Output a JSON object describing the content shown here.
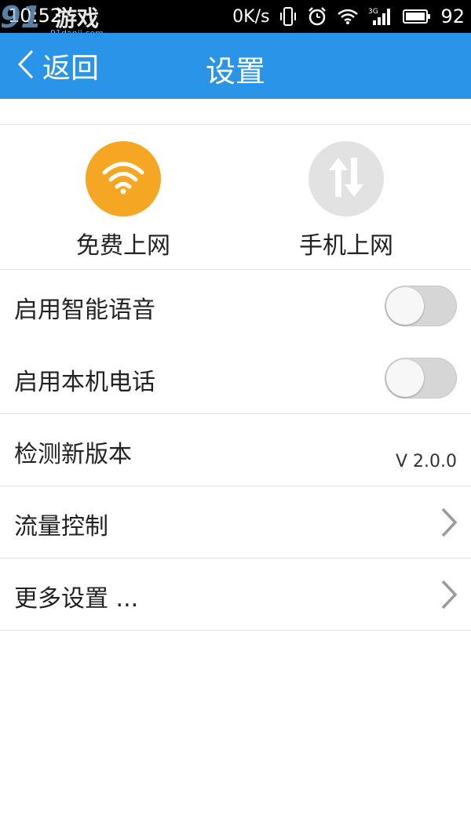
{
  "status_bar": {
    "time": "10:52",
    "speed": "0K/s",
    "battery_level": "92",
    "network_type": "3G"
  },
  "watermark": {
    "logo": "91",
    "name": "游戏",
    "url": "91danji.com"
  },
  "header": {
    "back_label": "返回",
    "title": "设置"
  },
  "network_modes": [
    {
      "label": "免费上网",
      "icon": "wifi-icon",
      "color": "#f5a623",
      "active": true
    },
    {
      "label": "手机上网",
      "icon": "updown-arrows-icon",
      "color": "#e2e2e2",
      "active": false
    }
  ],
  "settings": {
    "smart_voice": {
      "label": "启用智能语音",
      "enabled": false
    },
    "local_phone": {
      "label": "启用本机电话",
      "enabled": false
    },
    "check_version": {
      "label": "检测新版本",
      "version": "V 2.0.0"
    },
    "traffic_control": {
      "label": "流量控制"
    },
    "more_settings": {
      "label": "更多设置 ..."
    }
  },
  "colors": {
    "header_bg": "#2a95e8",
    "toggle_off": "#d6d6d6",
    "divider": "#e4e4e4"
  }
}
